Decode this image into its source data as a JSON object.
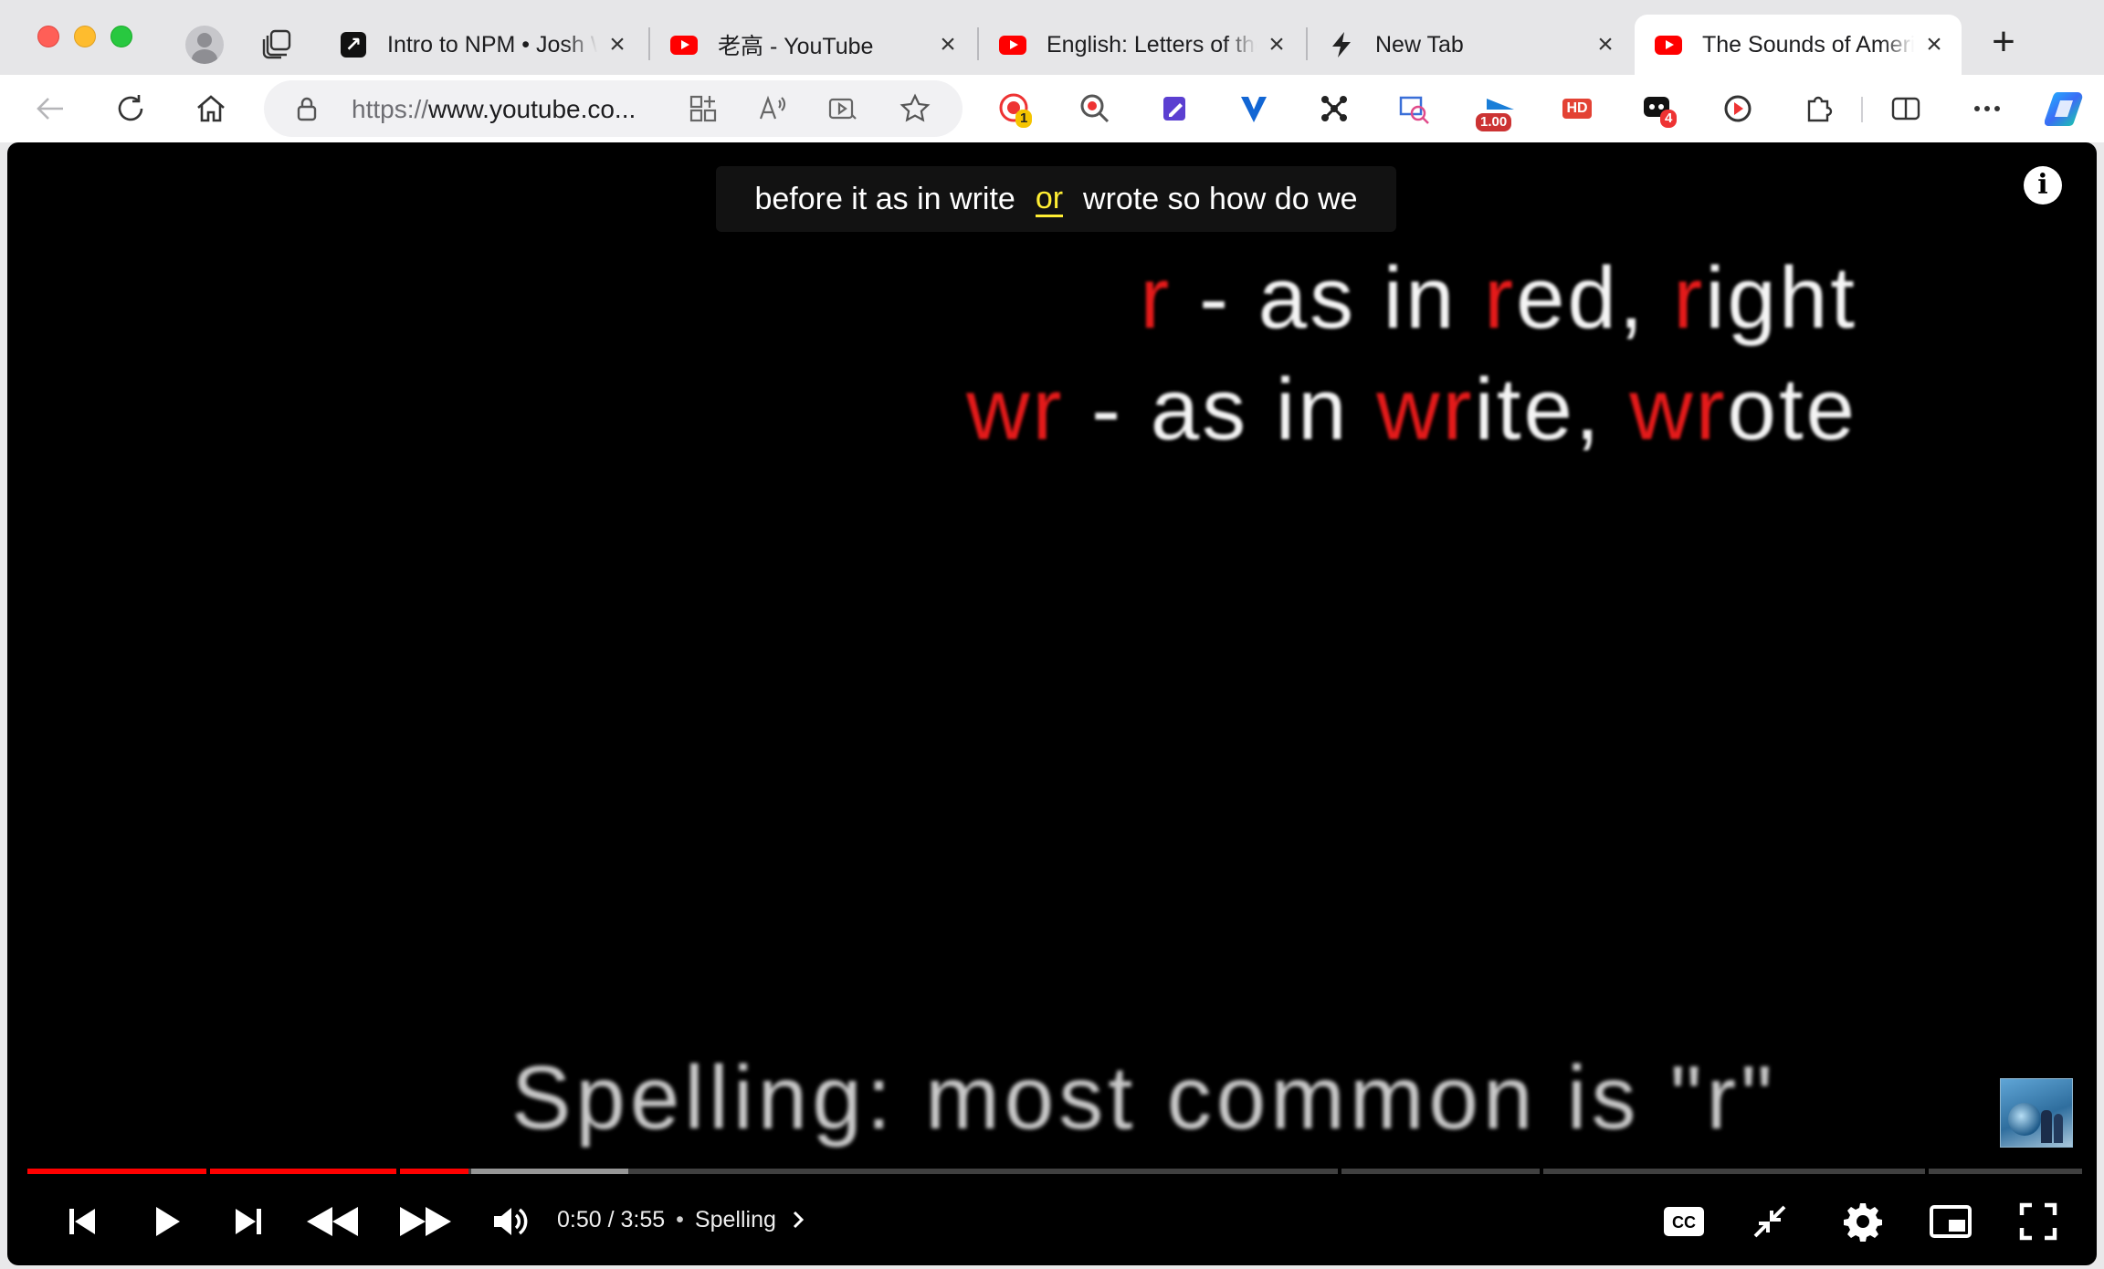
{
  "window": {
    "traffic_lights": [
      "close",
      "minimize",
      "zoom"
    ]
  },
  "tabs": [
    {
      "title": "Intro to NPM • Josh W Comeau",
      "favicon": "arrow-up-right-icon",
      "active": false
    },
    {
      "title": "老高 - YouTube",
      "favicon": "youtube-icon",
      "active": false
    },
    {
      "title": "English: Letters of the Alphabet",
      "favicon": "youtube-icon",
      "active": false
    },
    {
      "title": "New Tab",
      "favicon": "lightning-icon",
      "active": false
    },
    {
      "title": "The Sounds of American English",
      "favicon": "youtube-icon",
      "active": true
    }
  ],
  "toolbar": {
    "url_scheme": "https://",
    "url_rest": "www.youtube.co...",
    "extensions": [
      {
        "name": "record-extension-icon",
        "badge": "1"
      },
      {
        "name": "search-extension-icon",
        "badge": ""
      },
      {
        "name": "notes-extension-icon",
        "badge": ""
      },
      {
        "name": "vpn-extension-icon",
        "badge": ""
      },
      {
        "name": "ai-extension-icon",
        "badge": ""
      },
      {
        "name": "translate-extension-icon",
        "badge": ""
      },
      {
        "name": "speed-extension-icon",
        "badge": "1.00"
      },
      {
        "name": "hd-extension-icon",
        "badge": "HD"
      },
      {
        "name": "chat-extension-icon",
        "badge": "4"
      },
      {
        "name": "video-extension-icon",
        "badge": ""
      }
    ]
  },
  "video": {
    "caption": {
      "before": "before it as in write",
      "highlight": "or",
      "after": "wrote so how do we"
    },
    "slide": {
      "line1": [
        {
          "t": "r",
          "red": true
        },
        {
          "t": " - as in ",
          "red": false
        },
        {
          "t": "r",
          "red": true
        },
        {
          "t": "ed, ",
          "red": false
        },
        {
          "t": "r",
          "red": true
        },
        {
          "t": "ight",
          "red": false
        }
      ],
      "line2": [
        {
          "t": "wr",
          "red": true
        },
        {
          "t": " - as in ",
          "red": false
        },
        {
          "t": "wr",
          "red": true
        },
        {
          "t": "ite, ",
          "red": false
        },
        {
          "t": "wr",
          "red": true
        },
        {
          "t": "ote",
          "red": false
        }
      ],
      "footer": "Spelling:  most common is \"r\""
    },
    "player": {
      "current_time": "0:50",
      "duration": "3:55",
      "time_text": "0:50 / 3:55",
      "dot": "•",
      "chapter": "Spelling",
      "progress_fraction": 0.2128,
      "accent_color": "#ff0000"
    }
  }
}
